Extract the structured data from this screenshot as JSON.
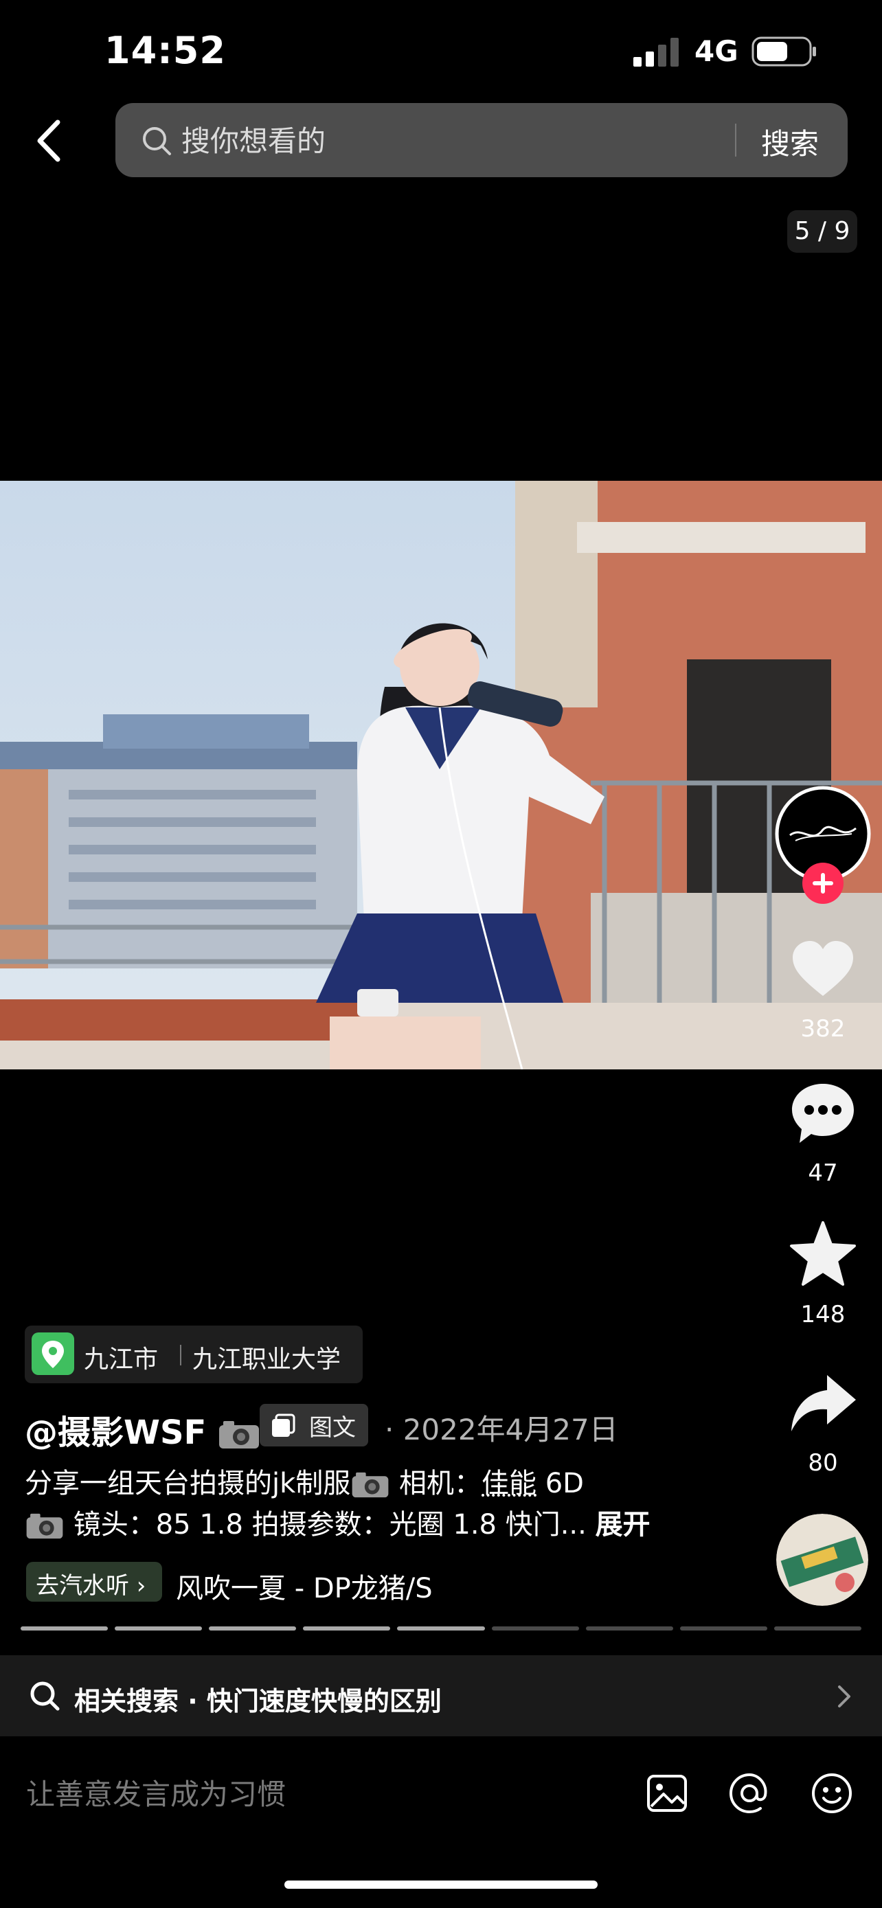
{
  "status_bar": {
    "time": "14:52",
    "network": "4G"
  },
  "search": {
    "placeholder": "搜你想看的",
    "button_label": "搜索"
  },
  "page_counter": "5 / 9",
  "rail": {
    "likes": "382",
    "comments": "47",
    "favorites": "148",
    "shares": "80"
  },
  "post": {
    "location_city": "九江市",
    "location_place": "九江职业大学",
    "author": "@摄影WSF",
    "tag": "图文",
    "date": "· 2022年4月27日",
    "desc_line1_a": "分享一组天台拍摄的jk制服",
    "desc_line1_b": " 相机：",
    "desc_line1_brand": "佳能",
    "desc_line1_c": " 6D",
    "desc_line2": " 镜头：85 1.8 拍摄参数：光圈 1.8 快门...",
    "expand": "展开",
    "music_chip": "去汽水听 ›",
    "music": "风吹一夏 - DP龙猪/S"
  },
  "progress": {
    "total": 9,
    "current": 5
  },
  "related": {
    "label": "相关搜索 · 快门速度快慢的区别"
  },
  "comment": {
    "placeholder": "让善意发言成为习惯"
  },
  "colors": {
    "accent_red": "#fe2c55",
    "location_green": "#3fbf5f"
  }
}
